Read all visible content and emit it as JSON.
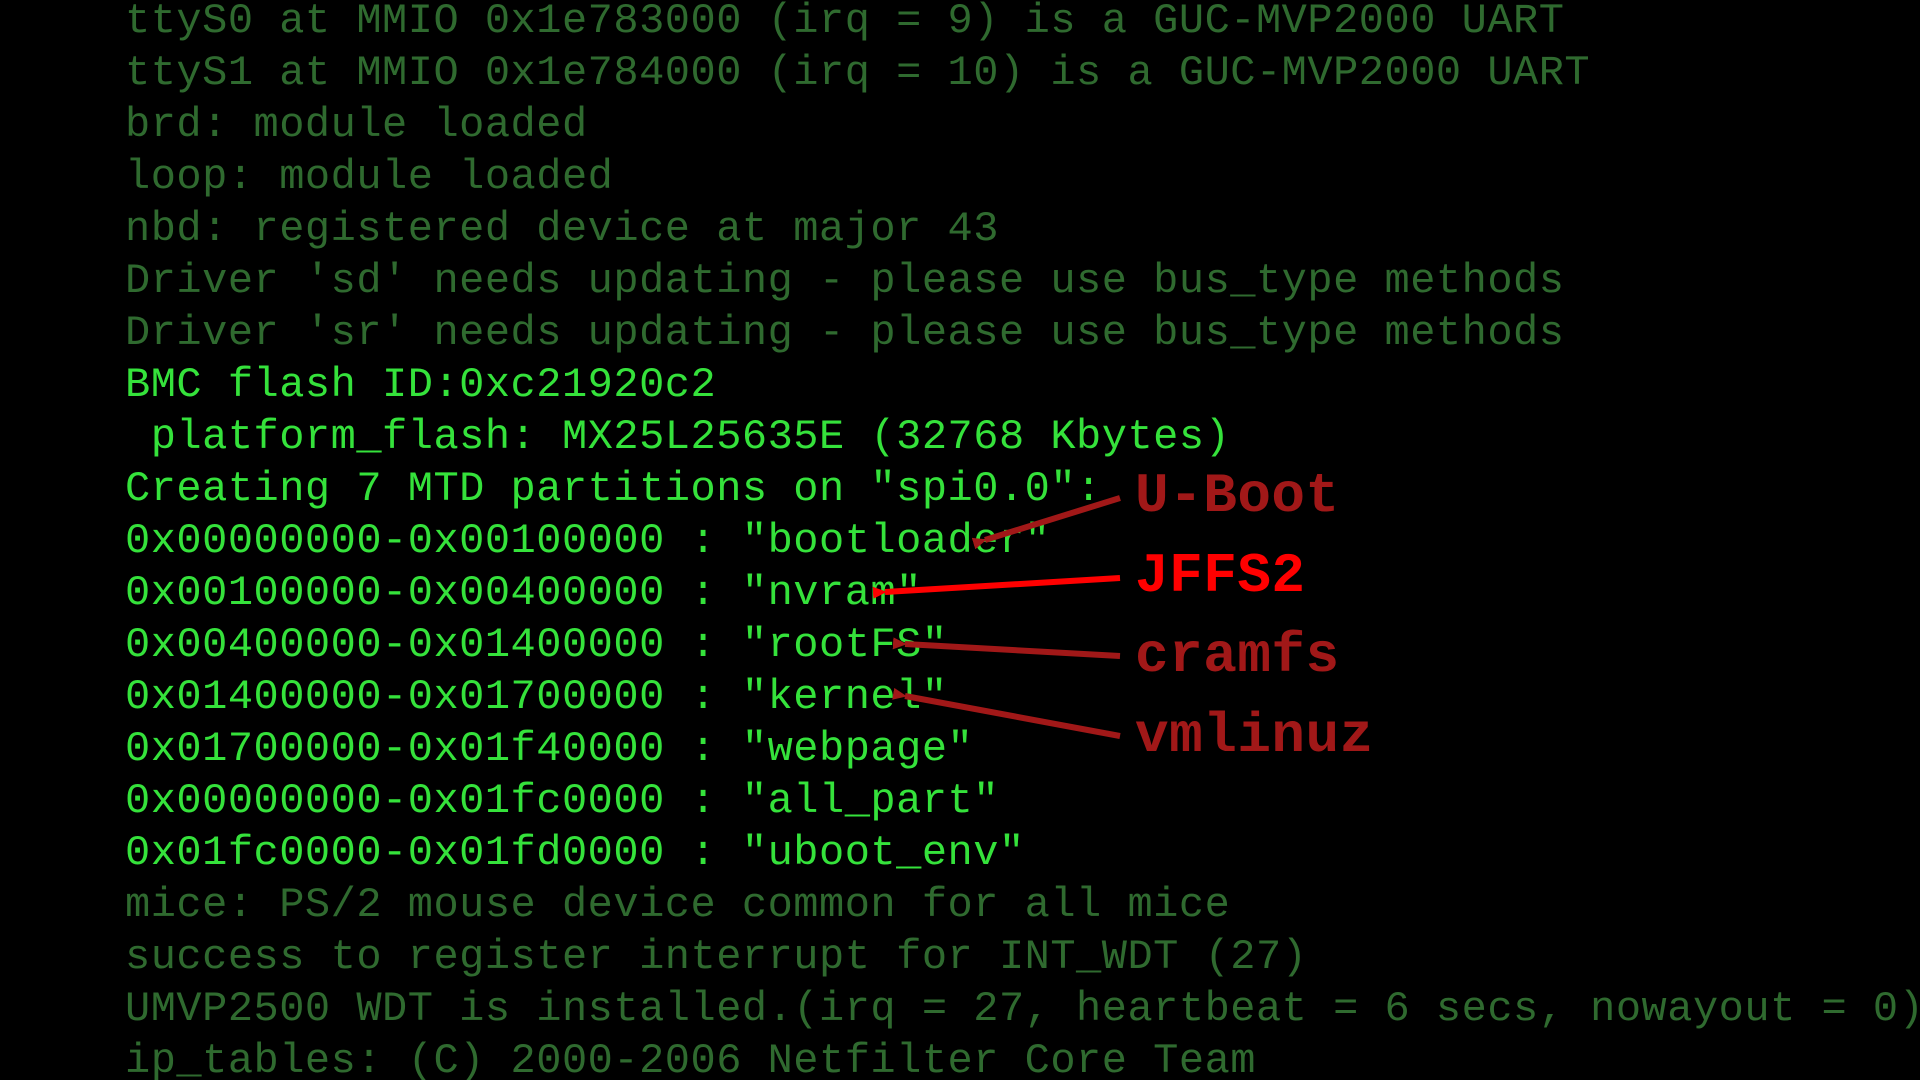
{
  "log": {
    "l0": "ttyS0 at MMIO 0x1e783000 (irq = 9) is a GUC-MVP2000 UART",
    "l1": "ttyS1 at MMIO 0x1e784000 (irq = 10) is a GUC-MVP2000 UART",
    "l2": "brd: module loaded",
    "l3": "loop: module loaded",
    "l4": "nbd: registered device at major 43",
    "l5": "Driver 'sd' needs updating - please use bus_type methods",
    "l6": "Driver 'sr' needs updating - please use bus_type methods",
    "l7": "BMC flash ID:0xc21920c2",
    "l8": " platform_flash: MX25L25635E (32768 Kbytes)",
    "l9": "Creating 7 MTD partitions on \"spi0.0\":",
    "l10": "0x00000000-0x00100000 : \"bootloader\"",
    "l11": "0x00100000-0x00400000 : \"nvram\"",
    "l12": "0x00400000-0x01400000 : \"rootFS\"",
    "l13": "0x01400000-0x01700000 : \"kernel\"",
    "l14": "0x01700000-0x01f40000 : \"webpage\"",
    "l15": "0x00000000-0x01fc0000 : \"all_part\"",
    "l16": "0x01fc0000-0x01fd0000 : \"uboot_env\"",
    "l17": "mice: PS/2 mouse device common for all mice",
    "l18": "success to register interrupt for INT_WDT (27)",
    "l19": "UMVP2500 WDT is installed.(irq = 27, heartbeat = 6 secs, nowayout = 0)",
    "l20": "ip_tables: (C) 2000-2006 Netfilter Core Team"
  },
  "annotations": {
    "uboot": "U-Boot",
    "jffs2": "JFFS2",
    "cramfs": "cramfs",
    "vmlinuz": "vmlinuz"
  },
  "colors": {
    "bg": "#000000",
    "dim_green": "#2f6a2f",
    "bright_green": "#35e23b",
    "red_bright": "#ff0000",
    "red_dim": "#a11818"
  }
}
